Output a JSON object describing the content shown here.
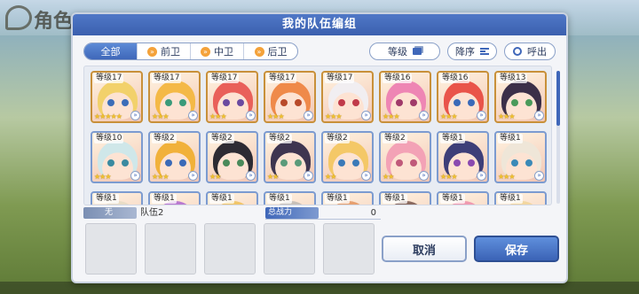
{
  "background": {
    "title": "角色"
  },
  "dialog": {
    "title": "我的队伍编组",
    "filters": [
      {
        "label": "全部",
        "active": true,
        "chevron": false
      },
      {
        "label": "前卫",
        "active": false,
        "chevron": true
      },
      {
        "label": "中卫",
        "active": false,
        "chevron": true
      },
      {
        "label": "后卫",
        "active": false,
        "chevron": true
      }
    ],
    "sort_key_label": "等级",
    "sort_order_label": "降序",
    "callout_label": "呼出"
  },
  "roster": [
    {
      "level": "等级17",
      "stars": "★★★★★",
      "rank_color": "#c8903a",
      "hair": "#f2d16b",
      "eye": "#3b6db8"
    },
    {
      "level": "等级17",
      "stars": "★★★",
      "rank_color": "#c8903a",
      "hair": "#f4b947",
      "eye": "#3a9a7a"
    },
    {
      "level": "等级17",
      "stars": "★★★",
      "rank_color": "#c8903a",
      "hair": "#e9605a",
      "eye": "#6a4aa0"
    },
    {
      "level": "等级17",
      "stars": "★★★",
      "rank_color": "#c8903a",
      "hair": "#ef8a4a",
      "eye": "#b84a2a"
    },
    {
      "level": "等级17",
      "stars": "★★★",
      "rank_color": "#c8903a",
      "hair": "#f1eef1",
      "eye": "#c03a4a"
    },
    {
      "level": "等级16",
      "stars": "★★★",
      "rank_color": "#c8903a",
      "hair": "#ee86b4",
      "eye": "#a03a6a"
    },
    {
      "level": "等级16",
      "stars": "★★★",
      "rank_color": "#c8903a",
      "hair": "#e9544a",
      "eye": "#3a6ab8"
    },
    {
      "level": "等级13",
      "stars": "★★★",
      "rank_color": "#c8903a",
      "hair": "#3b2f48",
      "eye": "#4a9a5a"
    },
    {
      "level": "等级10",
      "stars": "★★★",
      "rank_color": "#7c9bd0",
      "hair": "#cfe7e9",
      "eye": "#3a8aa0"
    },
    {
      "level": "等级2",
      "stars": "★★★",
      "rank_color": "#7c9bd0",
      "hair": "#f1b13a",
      "eye": "#3a6ab8"
    },
    {
      "level": "等级2",
      "stars": "★★",
      "rank_color": "#7c9bd0",
      "hair": "#2d2b33",
      "eye": "#4a8a5a"
    },
    {
      "level": "等级2",
      "stars": "★★",
      "rank_color": "#7c9bd0",
      "hair": "#3e3550",
      "eye": "#5a9a7a"
    },
    {
      "level": "等级2",
      "stars": "★★",
      "rank_color": "#7c9bd0",
      "hair": "#f4c867",
      "eye": "#3a7ab8"
    },
    {
      "level": "等级2",
      "stars": "★★",
      "rank_color": "#7c9bd0",
      "hair": "#f3a2b6",
      "eye": "#c05a7a"
    },
    {
      "level": "等级1",
      "stars": "★★★",
      "rank_color": "#7c9bd0",
      "hair": "#3d3e78",
      "eye": "#8a4ab0"
    },
    {
      "level": "等级1",
      "stars": "★★★",
      "rank_color": "#7c9bd0",
      "hair": "#efe6d8",
      "eye": "#3a8ab8"
    },
    {
      "level": "等级1",
      "stars": "★★★",
      "rank_color": "#7c9bd0",
      "hair": "#e8dcc6",
      "eye": "#5a6ab8"
    },
    {
      "level": "等级1",
      "stars": "",
      "rank_color": "#7c9bd0",
      "hair": "#b97ad0",
      "eye": "#5a3a8a"
    },
    {
      "level": "等级1",
      "stars": "",
      "rank_color": "#7c9bd0",
      "hair": "#f0c56a",
      "eye": "#3a6ab8"
    },
    {
      "level": "等级1",
      "stars": "",
      "rank_color": "#7c9bd0",
      "hair": "#c8c0b8",
      "eye": "#4a6a8a"
    },
    {
      "level": "等级1",
      "stars": "",
      "rank_color": "#7c9bd0",
      "hair": "#e6a070",
      "eye": "#3a6ab8"
    },
    {
      "level": "等级1",
      "stars": "",
      "rank_color": "#7c9bd0",
      "hair": "#8a6a60",
      "eye": "#4a4a6a"
    },
    {
      "level": "等级1",
      "stars": "",
      "rank_color": "#7c9bd0",
      "hair": "#ef9ab0",
      "eye": "#3a6ab8"
    },
    {
      "level": "等级1",
      "stars": "",
      "rank_color": "#7c9bd0",
      "hair": "#f2d6a0",
      "eye": "#3a6ab8"
    }
  ],
  "party": {
    "tag": "无",
    "name": "队伍2",
    "power_label": "总战力",
    "power_value": "0",
    "slots": 5
  },
  "buttons": {
    "cancel": "取消",
    "save": "保存"
  },
  "colors": {
    "accent": "#3f67b9",
    "header": "#4f78c7"
  }
}
